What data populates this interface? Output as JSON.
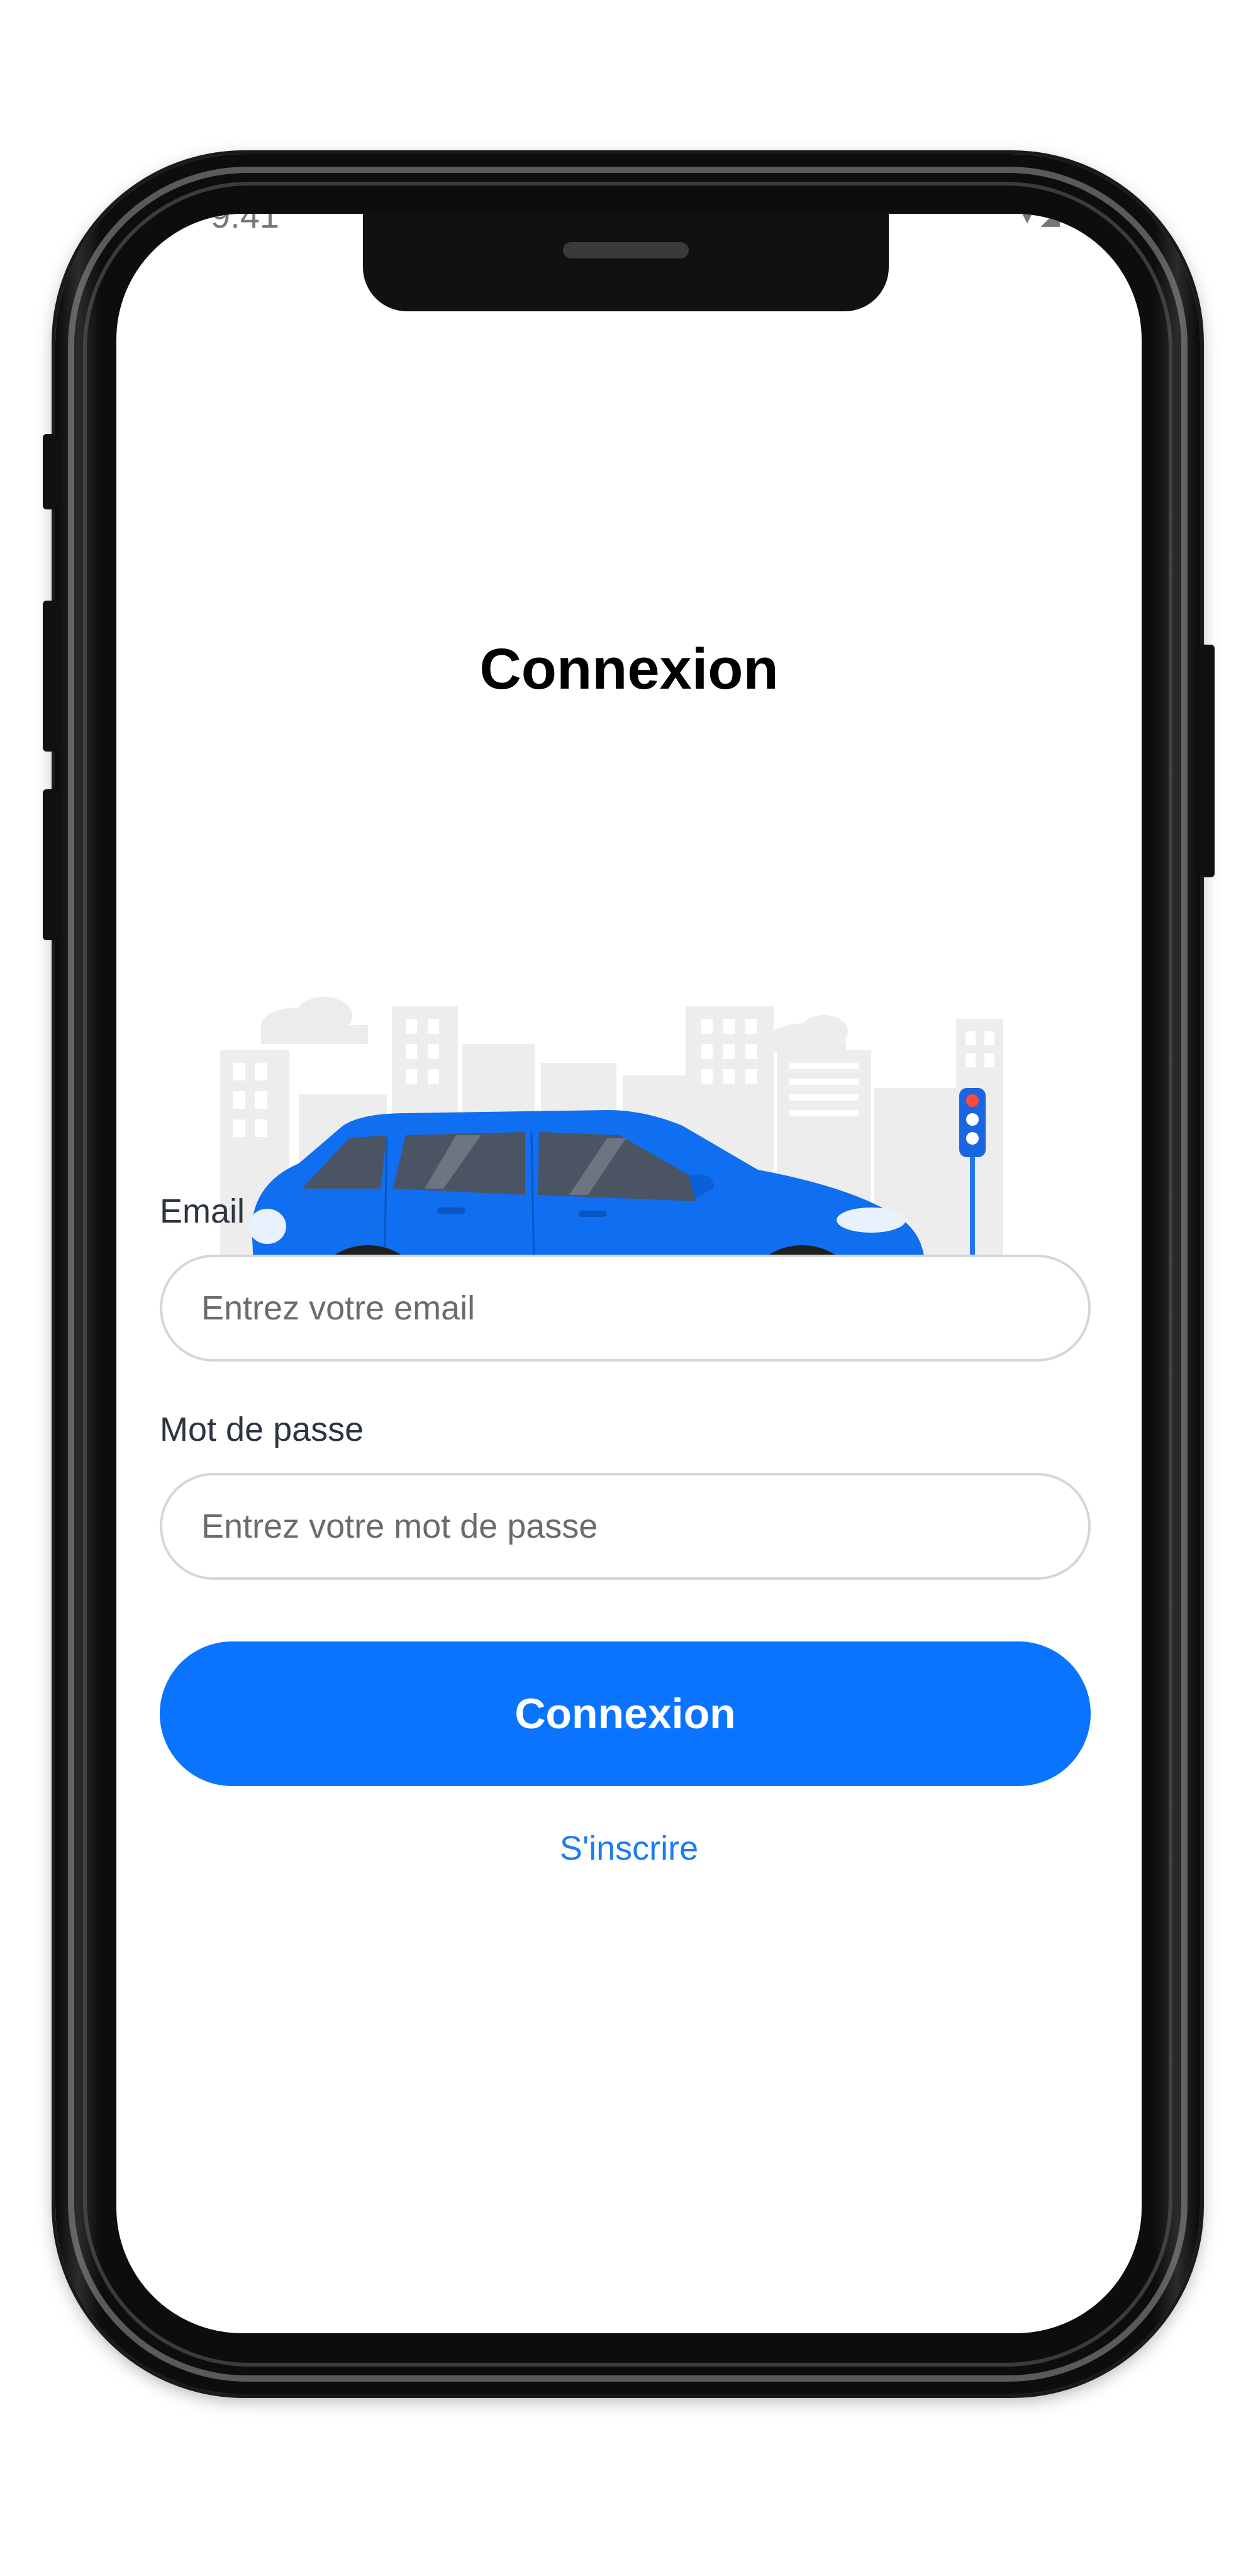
{
  "login": {
    "title": "Connexion",
    "email_label": "Email",
    "email_placeholder": "Entrez votre email",
    "email_value": "",
    "password_label": "Mot de passe",
    "password_placeholder": "Entrez votre mot de passe",
    "password_value": "",
    "submit_label": "Connexion",
    "signup_link": "S'inscrire"
  },
  "status_bar": {
    "time": "9:41"
  },
  "illustration": {
    "subject": "blue-car-city-illustration",
    "car_color": "#0f6ff0"
  },
  "colors": {
    "accent": "#0a74ff",
    "link": "#1c7cf2",
    "text": "#000000",
    "label": "#2c3440"
  }
}
